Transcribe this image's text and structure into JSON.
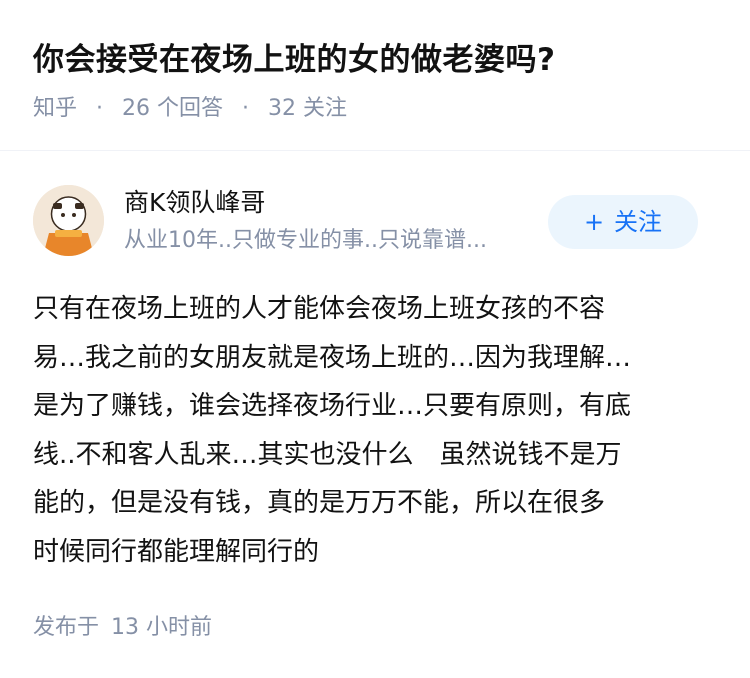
{
  "question": {
    "title": "你会接受在夜场上班的女的做老婆吗?",
    "source": "知乎",
    "answers_count": "26",
    "answers_label": "个回答",
    "followers_count": "32",
    "followers_label": "关注",
    "separator": "·"
  },
  "author": {
    "name": "商K领队峰哥",
    "bio": "从业10年..只做专业的事..只说靠谱...",
    "follow_label": "关注",
    "follow_icon": "plus-icon"
  },
  "answer": {
    "lines": [
      "只有在夜场上班的人才能体会夜场上班女孩的不容",
      "易…我之前的女朋友就是夜场上班的…因为我理解…",
      "是为了赚钱，谁会选择夜场行业…只要有原则，有底",
      "线..不和客人乱来…其实也没什么　虽然说钱不是万",
      "能的，但是没有钱，真的是万万不能，所以在很多",
      "时候同行都能理解同行的"
    ]
  },
  "footer": {
    "posted_label": "发布于",
    "posted_time": "13 小时前"
  },
  "colors": {
    "title": "#121212",
    "meta": "#8590a6",
    "follow_bg": "#ebf5fd",
    "follow_text": "#1772f6",
    "avatar_bg": "#f3e7d8",
    "avatar_accent": "#e8862a"
  }
}
